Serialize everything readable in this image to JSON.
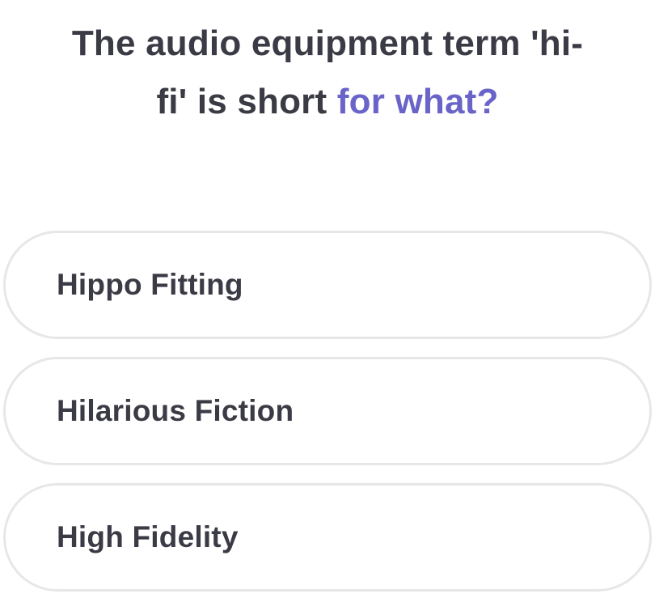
{
  "question": {
    "line1": "The audio equipment term 'hi-",
    "line2_plain": "fi' is short ",
    "line2_accent": "for what?"
  },
  "options": [
    {
      "label": "Hippo Fitting"
    },
    {
      "label": "Hilarious Fiction"
    },
    {
      "label": "High Fidelity"
    }
  ],
  "colors": {
    "text": "#3b3b46",
    "accent": "#6a64c9",
    "option_border": "#e7e7ea",
    "background": "#ffffff"
  }
}
